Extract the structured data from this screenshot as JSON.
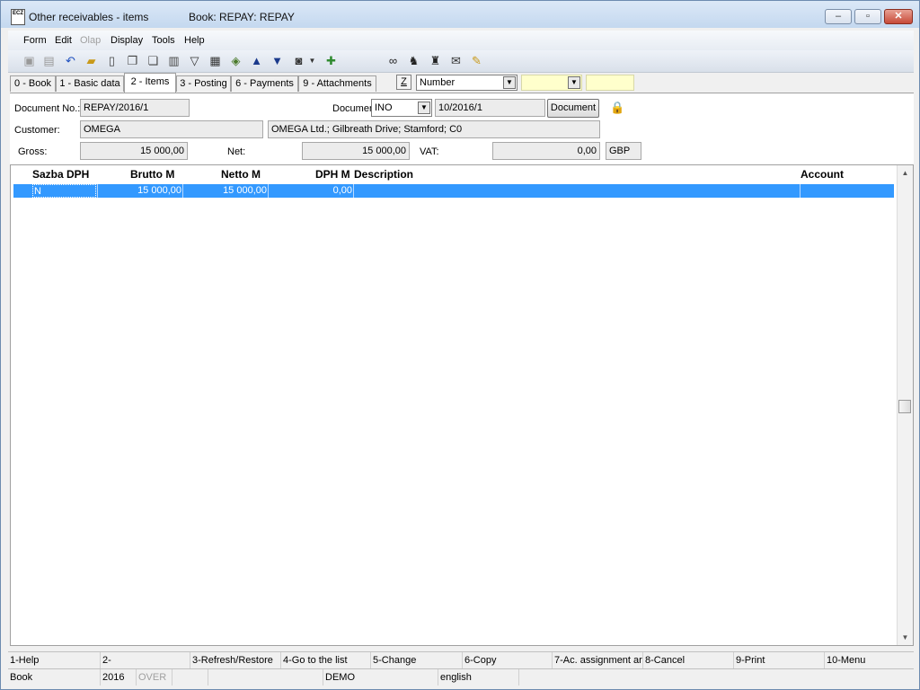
{
  "window": {
    "title": "Other receivables - items",
    "book_title": "Book: REPAY: REPAY",
    "app_icon_text": "ECZ",
    "minimize": "–",
    "maximize": "▫",
    "close": "✕"
  },
  "menu": [
    "Form",
    "Edit",
    "Olap",
    "Display",
    "Tools",
    "Help"
  ],
  "menu_disabled": [
    "Olap"
  ],
  "toolbar_icons": [
    "save-icon",
    "save-as-icon",
    "undo-icon",
    "open-folder-icon",
    "new-document-icon",
    "copy-document-icon",
    "paste-icon",
    "book-icon",
    "filter-icon",
    "filter-document-icon",
    "money-icon",
    "arrow-up-icon",
    "arrow-down-icon",
    "camera-icon",
    "dropdown-icon",
    "pin-icon",
    "binoculars-icon",
    "find-next-icon",
    "find-all-icon",
    "envelope-icon",
    "folder-edit-icon"
  ],
  "tabs": [
    "0 - Book",
    "1 - Basic data",
    "2 - Items",
    "3 - Posting",
    "6 - Payments",
    "9 - Attachments"
  ],
  "active_tab": "2 - Items",
  "z_button": "Z",
  "sort_select": {
    "value": "Number"
  },
  "form": {
    "document_no_label": "Document No.:",
    "document_no": "REPAY/2016/1",
    "document_label": "Documer",
    "document_type": "INO",
    "document_ref": "10/2016/1",
    "document_button": "Document",
    "customer_label": "Customer:",
    "customer_code": "OMEGA",
    "customer_address": "OMEGA Ltd.; Gilbreath Drive; Stamford; C0",
    "gross_label": "Gross:",
    "gross": "15 000,00",
    "net_label": "Net:",
    "net": "15 000,00",
    "vat_label": "VAT:",
    "vat": "0,00",
    "currency": "GBP"
  },
  "grid": {
    "headers": [
      "Sazba DPH",
      "Brutto M",
      "Netto M",
      "DPH M",
      "Description",
      "Account"
    ],
    "rows": [
      {
        "sazba": "N",
        "brutto": "15 000,00",
        "netto": "15 000,00",
        "dph": "0,00",
        "description": "",
        "account": ""
      }
    ]
  },
  "function_keys": [
    "1-Help",
    "2-",
    "3-Refresh/Restore",
    "4-Go to the list",
    "5-Change",
    "6-Copy",
    "7-Ac. assignment ar",
    "8-Cancel",
    "9-Print",
    "10-Menu"
  ],
  "status": [
    "Book",
    "2016",
    "OVER",
    "",
    "DEMO",
    "english",
    ""
  ]
}
